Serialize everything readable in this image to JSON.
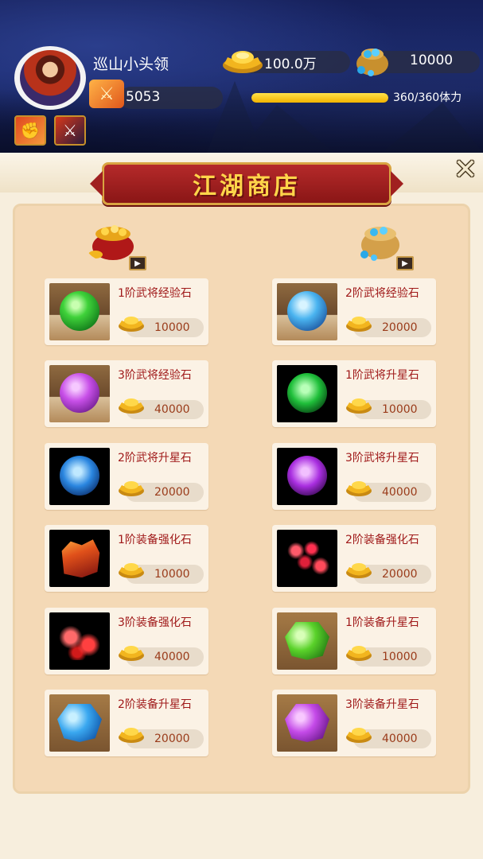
{
  "player": {
    "name": "巡山小头领",
    "power": "5053"
  },
  "resources": {
    "gold": "100.0万",
    "gems": "10000",
    "stamina_text": "360/360体力",
    "stamina_fraction": 1.0
  },
  "shop": {
    "title": "江湖商店",
    "left_currency_icon": "gold-moneybag-icon",
    "right_currency_icon": "gem-moneybag-icon",
    "left_items": [
      {
        "name": "1阶武将经验石",
        "price": "10000",
        "icon": "green-orb-icon"
      },
      {
        "name": "3阶武将经验石",
        "price": "40000",
        "icon": "purple-orb-icon"
      },
      {
        "name": "2阶武将升星石",
        "price": "20000",
        "icon": "blue-star-orb-icon"
      },
      {
        "name": "1阶装备强化石",
        "price": "10000",
        "icon": "red-crystal-cluster-icon"
      },
      {
        "name": "3阶装备强化石",
        "price": "40000",
        "icon": "red-shards-icon"
      },
      {
        "name": "2阶装备升星石",
        "price": "20000",
        "icon": "blue-gem-icon"
      }
    ],
    "right_items": [
      {
        "name": "2阶武将经验石",
        "price": "20000",
        "icon": "blue-orb-icon"
      },
      {
        "name": "1阶武将升星石",
        "price": "10000",
        "icon": "green-star-orb-icon"
      },
      {
        "name": "3阶武将升星石",
        "price": "40000",
        "icon": "purple-star-orb-icon"
      },
      {
        "name": "2阶装备强化石",
        "price": "20000",
        "icon": "red-sparkle-shards-icon"
      },
      {
        "name": "1阶装备升星石",
        "price": "10000",
        "icon": "green-gem-icon"
      },
      {
        "name": "3阶装备升星石",
        "price": "40000",
        "icon": "purple-gem-icon"
      }
    ]
  },
  "colors": {
    "item_name": "#a01a1a",
    "banner_red": "#a01d1d",
    "banner_text": "#ffd54a",
    "stamina_fill": "#f3b300"
  }
}
